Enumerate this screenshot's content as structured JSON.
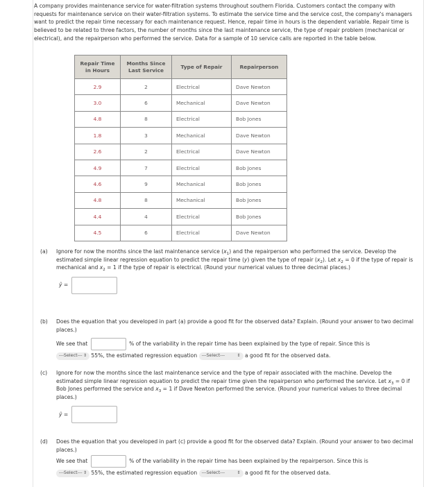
{
  "intro": "A company provides maintenance service for water-filtration systems throughout southern Florida. Customers contact the company with requests for maintenance service on their water-filtration systems. To estimate the service time and the service cost, the company's managers want to predict the repair time necessary for each maintenance request. Hence, repair time in hours is the dependent variable. Repair time is believed to be related to three factors, the number of months since the last maintenance service, the type of repair problem (mechanical or electrical), and the repairperson who performed the service. Data for a sample of 10 service calls are reported in the table below.",
  "table": {
    "headers": [
      "Repair Time in Hours",
      "Months Since Last Service",
      "Type of Repair",
      "Repairperson"
    ],
    "header_lines": [
      [
        "Repair Time",
        "in Hours"
      ],
      [
        "Months Since",
        "Last Service"
      ],
      [
        "Type of Repair"
      ],
      [
        "Repairperson"
      ]
    ],
    "rows": [
      [
        "2.9",
        "2",
        "Electrical",
        "Dave Newton"
      ],
      [
        "3.0",
        "6",
        "Mechanical",
        "Dave Newton"
      ],
      [
        "4.8",
        "8",
        "Electrical",
        "Bob Jones"
      ],
      [
        "1.8",
        "3",
        "Mechanical",
        "Dave Newton"
      ],
      [
        "2.6",
        "2",
        "Electrical",
        "Dave Newton"
      ],
      [
        "4.9",
        "7",
        "Electrical",
        "Bob Jones"
      ],
      [
        "4.6",
        "9",
        "Mechanical",
        "Bob Jones"
      ],
      [
        "4.8",
        "8",
        "Mechanical",
        "Bob Jones"
      ],
      [
        "4.4",
        "4",
        "Electrical",
        "Bob Jones"
      ],
      [
        "4.5",
        "6",
        "Electrical",
        "Dave Newton"
      ]
    ]
  },
  "parts": {
    "a": {
      "label": "(a)",
      "t1": "Ignore for now the months since the last maintenance service (",
      "x": "x",
      "sub1": "1",
      "t2": ") and the repairperson who performed the service.",
      "t3": "Develop the estimated simple linear regression equation to predict the repair time (",
      "y": "y",
      "t4": ") given the type of repair (",
      "sub2": "2",
      "t5": "). Let",
      "t6": " = 0 if the type of repair is mechanical and ",
      "t7": " = 1 if the type of repair is electrical. (Round your numerical values to three decimal places.)",
      "yhat": "ŷ =",
      "answer": ""
    },
    "b": {
      "label": "(b)",
      "question": "Does the equation that you developed in part (a) provide a good fit for the observed data? Explain. (Round your answer to two decimal places.)",
      "we_see": "We see that",
      "answer": "",
      "after_input": "% of the variability in the repair time has been explained by the type of repair. Since this is",
      "select1": "---Select---",
      "mid": "55%, the estimated regression equation",
      "select2": "---Select---",
      "end": "a good fit for the observed data."
    },
    "c": {
      "label": "(c)",
      "t1": "Ignore for now the months since the last maintenance service and the type of repair associated with the machine. Develop the estimated simple linear regression equation to predict the repair time given the repairperson who performed the service.",
      "t2": "Let ",
      "x": "x",
      "sub": "3",
      "t3": " = 0 if Bob Jones performed the service and ",
      "t4": " = 1 if Dave Newton performed the service. (Round your numerical values to three decimal places.)",
      "yhat": "ŷ =",
      "answer": ""
    },
    "d": {
      "label": "(d)",
      "question": "Does the equation that you developed in part (c) provide a good fit for the observed data? Explain. (Round your answer to two decimal places.)",
      "we_see": "We see that",
      "answer": "",
      "after_input": "% of the variability in the repair time has been explained by the repairperson. Since this is",
      "select1": "---Select---",
      "mid": "55%, the estimated regression equation",
      "select2": "---Select---",
      "end": "a good fit for the observed data."
    }
  },
  "icons": {
    "select_chevron": "⇕"
  }
}
